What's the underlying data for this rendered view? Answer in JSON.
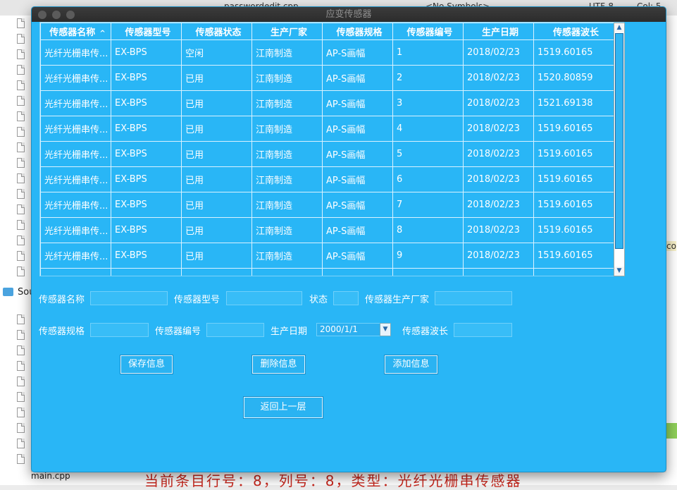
{
  "ide": {
    "tab_file": "passwordedit.cpp",
    "symbols": "<No Symbols>",
    "encoding_partial": "UTF-8",
    "col_partial": "Col: 5",
    "folder_label_partial": "Sou",
    "file_label": "main.cpp",
    "right_label_partial": "co",
    "bottom_text_partial": "当前条目行号：8，列号：8，类型：光纤光栅串传感器"
  },
  "window": {
    "title": "应变传感器"
  },
  "table": {
    "columns": [
      "传感器名称",
      "传感器型号",
      "传感器状态",
      "生产厂家",
      "传感器规格",
      "传感器编号",
      "生产日期",
      "传感器波长"
    ],
    "sort_indicator": "^",
    "rows": [
      [
        "光纤光栅串传...",
        "EX-BPS",
        "空闲",
        "江南制造",
        "AP-S画幅",
        "1",
        "2018/02/23",
        "1519.60165"
      ],
      [
        "光纤光栅串传...",
        "EX-BPS",
        "已用",
        "江南制造",
        "AP-S画幅",
        "2",
        "2018/02/23",
        "1520.80859"
      ],
      [
        "光纤光栅串传...",
        "EX-BPS",
        "已用",
        "江南制造",
        "AP-S画幅",
        "3",
        "2018/02/23",
        "1521.69138"
      ],
      [
        "光纤光栅串传...",
        "EX-BPS",
        "已用",
        "江南制造",
        "AP-S画幅",
        "4",
        "2018/02/23",
        "1519.60165"
      ],
      [
        "光纤光栅串传...",
        "EX-BPS",
        "已用",
        "江南制造",
        "AP-S画幅",
        "5",
        "2018/02/23",
        "1519.60165"
      ],
      [
        "光纤光栅串传...",
        "EX-BPS",
        "已用",
        "江南制造",
        "AP-S画幅",
        "6",
        "2018/02/23",
        "1519.60165"
      ],
      [
        "光纤光栅串传...",
        "EX-BPS",
        "已用",
        "江南制造",
        "AP-S画幅",
        "7",
        "2018/02/23",
        "1519.60165"
      ],
      [
        "光纤光栅串传...",
        "EX-BPS",
        "已用",
        "江南制造",
        "AP-S画幅",
        "8",
        "2018/02/23",
        "1519.60165"
      ],
      [
        "光纤光栅串传...",
        "EX-BPS",
        "已用",
        "江南制造",
        "AP-S画幅",
        "9",
        "2018/02/23",
        "1519.60165"
      ],
      [
        "",
        "",
        "",
        "",
        "",
        "",
        "",
        ""
      ]
    ]
  },
  "form": {
    "name_label": "传感器名称",
    "model_label": "传感器型号",
    "status_label": "状态",
    "maker_label": "传感器生产厂家",
    "spec_label": "传感器规格",
    "number_label": "传感器编号",
    "date_label": "生产日期",
    "date_value": "2000/1/1",
    "wavelength_label": "传感器波长",
    "name_value": "",
    "model_value": "",
    "status_value": "",
    "maker_value": "",
    "spec_value": "",
    "number_value": "",
    "wavelength_value": ""
  },
  "buttons": {
    "save": "保存信息",
    "delete": "删除信息",
    "add": "添加信息",
    "back": "返回上一层"
  },
  "icons": {
    "scroll_up": "▲",
    "scroll_down": "▼",
    "date_dropdown": "▼"
  },
  "colors": {
    "window_bg": "#29b6f6",
    "titlebar": "#333333"
  }
}
